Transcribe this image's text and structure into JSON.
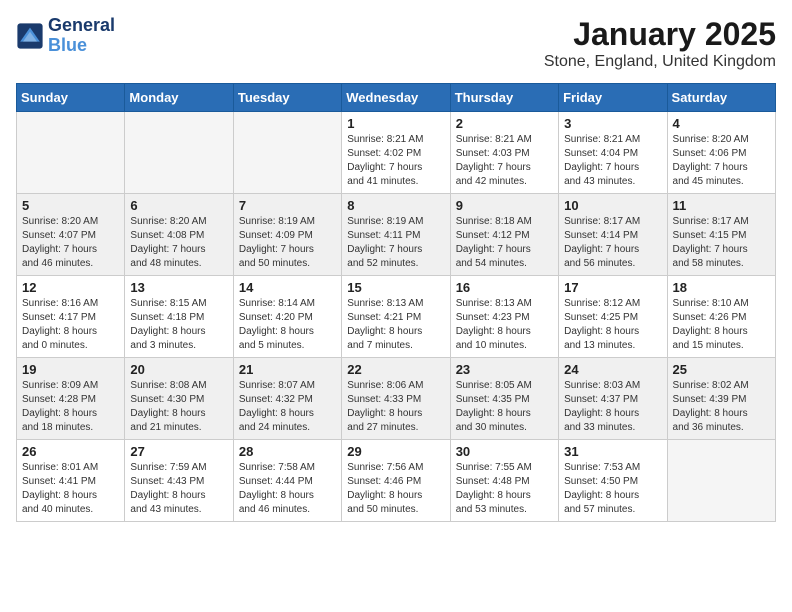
{
  "logo": {
    "line1": "General",
    "line2": "Blue"
  },
  "title": "January 2025",
  "subtitle": "Stone, England, United Kingdom",
  "weekdays": [
    "Sunday",
    "Monday",
    "Tuesday",
    "Wednesday",
    "Thursday",
    "Friday",
    "Saturday"
  ],
  "weeks": [
    [
      {
        "day": "",
        "info": "",
        "empty": true
      },
      {
        "day": "",
        "info": "",
        "empty": true
      },
      {
        "day": "",
        "info": "",
        "empty": true
      },
      {
        "day": "1",
        "info": "Sunrise: 8:21 AM\nSunset: 4:02 PM\nDaylight: 7 hours\nand 41 minutes."
      },
      {
        "day": "2",
        "info": "Sunrise: 8:21 AM\nSunset: 4:03 PM\nDaylight: 7 hours\nand 42 minutes."
      },
      {
        "day": "3",
        "info": "Sunrise: 8:21 AM\nSunset: 4:04 PM\nDaylight: 7 hours\nand 43 minutes."
      },
      {
        "day": "4",
        "info": "Sunrise: 8:20 AM\nSunset: 4:06 PM\nDaylight: 7 hours\nand 45 minutes."
      }
    ],
    [
      {
        "day": "5",
        "info": "Sunrise: 8:20 AM\nSunset: 4:07 PM\nDaylight: 7 hours\nand 46 minutes.",
        "shaded": true
      },
      {
        "day": "6",
        "info": "Sunrise: 8:20 AM\nSunset: 4:08 PM\nDaylight: 7 hours\nand 48 minutes.",
        "shaded": true
      },
      {
        "day": "7",
        "info": "Sunrise: 8:19 AM\nSunset: 4:09 PM\nDaylight: 7 hours\nand 50 minutes.",
        "shaded": true
      },
      {
        "day": "8",
        "info": "Sunrise: 8:19 AM\nSunset: 4:11 PM\nDaylight: 7 hours\nand 52 minutes.",
        "shaded": true
      },
      {
        "day": "9",
        "info": "Sunrise: 8:18 AM\nSunset: 4:12 PM\nDaylight: 7 hours\nand 54 minutes.",
        "shaded": true
      },
      {
        "day": "10",
        "info": "Sunrise: 8:17 AM\nSunset: 4:14 PM\nDaylight: 7 hours\nand 56 minutes.",
        "shaded": true
      },
      {
        "day": "11",
        "info": "Sunrise: 8:17 AM\nSunset: 4:15 PM\nDaylight: 7 hours\nand 58 minutes.",
        "shaded": true
      }
    ],
    [
      {
        "day": "12",
        "info": "Sunrise: 8:16 AM\nSunset: 4:17 PM\nDaylight: 8 hours\nand 0 minutes."
      },
      {
        "day": "13",
        "info": "Sunrise: 8:15 AM\nSunset: 4:18 PM\nDaylight: 8 hours\nand 3 minutes."
      },
      {
        "day": "14",
        "info": "Sunrise: 8:14 AM\nSunset: 4:20 PM\nDaylight: 8 hours\nand 5 minutes."
      },
      {
        "day": "15",
        "info": "Sunrise: 8:13 AM\nSunset: 4:21 PM\nDaylight: 8 hours\nand 7 minutes."
      },
      {
        "day": "16",
        "info": "Sunrise: 8:13 AM\nSunset: 4:23 PM\nDaylight: 8 hours\nand 10 minutes."
      },
      {
        "day": "17",
        "info": "Sunrise: 8:12 AM\nSunset: 4:25 PM\nDaylight: 8 hours\nand 13 minutes."
      },
      {
        "day": "18",
        "info": "Sunrise: 8:10 AM\nSunset: 4:26 PM\nDaylight: 8 hours\nand 15 minutes."
      }
    ],
    [
      {
        "day": "19",
        "info": "Sunrise: 8:09 AM\nSunset: 4:28 PM\nDaylight: 8 hours\nand 18 minutes.",
        "shaded": true
      },
      {
        "day": "20",
        "info": "Sunrise: 8:08 AM\nSunset: 4:30 PM\nDaylight: 8 hours\nand 21 minutes.",
        "shaded": true
      },
      {
        "day": "21",
        "info": "Sunrise: 8:07 AM\nSunset: 4:32 PM\nDaylight: 8 hours\nand 24 minutes.",
        "shaded": true
      },
      {
        "day": "22",
        "info": "Sunrise: 8:06 AM\nSunset: 4:33 PM\nDaylight: 8 hours\nand 27 minutes.",
        "shaded": true
      },
      {
        "day": "23",
        "info": "Sunrise: 8:05 AM\nSunset: 4:35 PM\nDaylight: 8 hours\nand 30 minutes.",
        "shaded": true
      },
      {
        "day": "24",
        "info": "Sunrise: 8:03 AM\nSunset: 4:37 PM\nDaylight: 8 hours\nand 33 minutes.",
        "shaded": true
      },
      {
        "day": "25",
        "info": "Sunrise: 8:02 AM\nSunset: 4:39 PM\nDaylight: 8 hours\nand 36 minutes.",
        "shaded": true
      }
    ],
    [
      {
        "day": "26",
        "info": "Sunrise: 8:01 AM\nSunset: 4:41 PM\nDaylight: 8 hours\nand 40 minutes."
      },
      {
        "day": "27",
        "info": "Sunrise: 7:59 AM\nSunset: 4:43 PM\nDaylight: 8 hours\nand 43 minutes."
      },
      {
        "day": "28",
        "info": "Sunrise: 7:58 AM\nSunset: 4:44 PM\nDaylight: 8 hours\nand 46 minutes."
      },
      {
        "day": "29",
        "info": "Sunrise: 7:56 AM\nSunset: 4:46 PM\nDaylight: 8 hours\nand 50 minutes."
      },
      {
        "day": "30",
        "info": "Sunrise: 7:55 AM\nSunset: 4:48 PM\nDaylight: 8 hours\nand 53 minutes."
      },
      {
        "day": "31",
        "info": "Sunrise: 7:53 AM\nSunset: 4:50 PM\nDaylight: 8 hours\nand 57 minutes."
      },
      {
        "day": "",
        "info": "",
        "empty": true
      }
    ]
  ]
}
